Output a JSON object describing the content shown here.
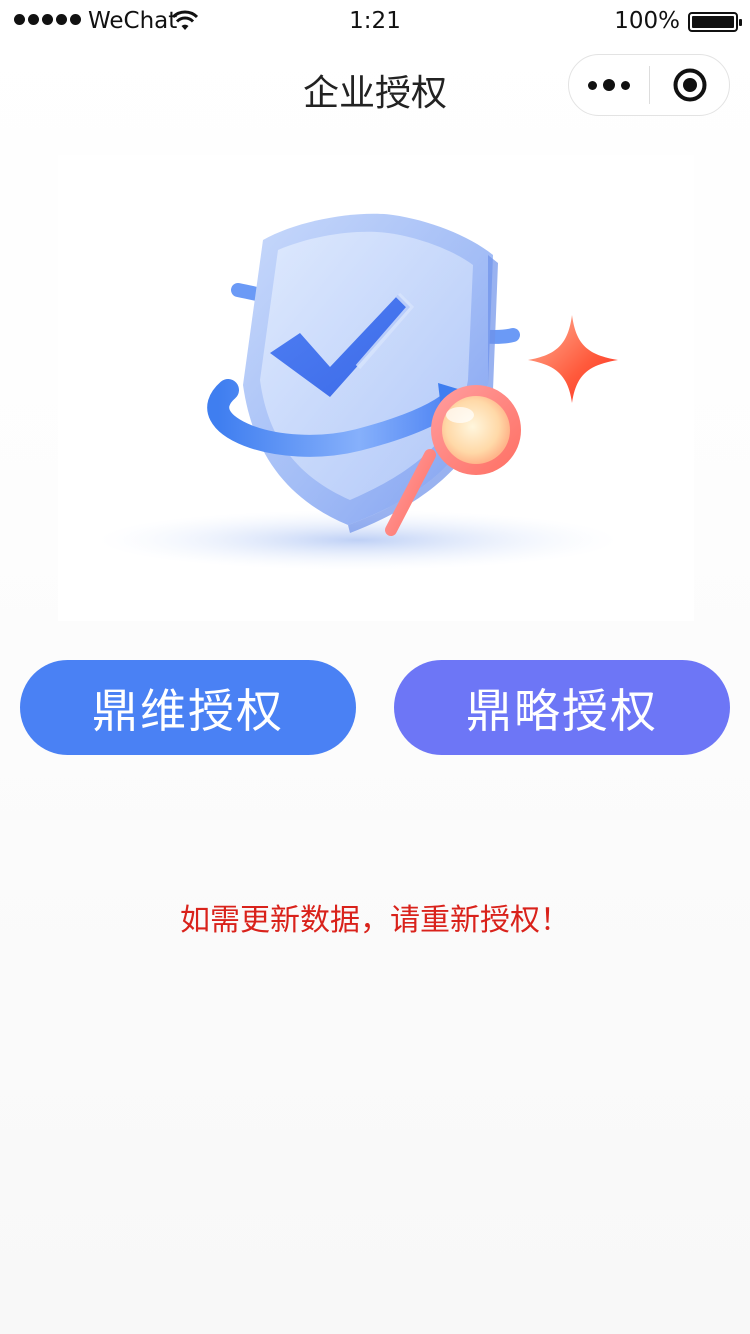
{
  "status_bar": {
    "carrier": "WeChat",
    "time": "1:21",
    "battery_percent": "100%",
    "battery_level": 1.0
  },
  "nav": {
    "title": "企业授权",
    "more_icon": "more-dots-icon",
    "close_icon": "target-close-icon"
  },
  "illustration": {
    "icon": "shield-check-magnifier-illustration"
  },
  "buttons": {
    "left_label": "鼎维授权",
    "right_label": "鼎略授权"
  },
  "notice": "如需更新数据，请重新授权！",
  "colors": {
    "left_button": "#4a81f4",
    "right_button": "#6d76f6",
    "notice_text": "#d9221b"
  }
}
